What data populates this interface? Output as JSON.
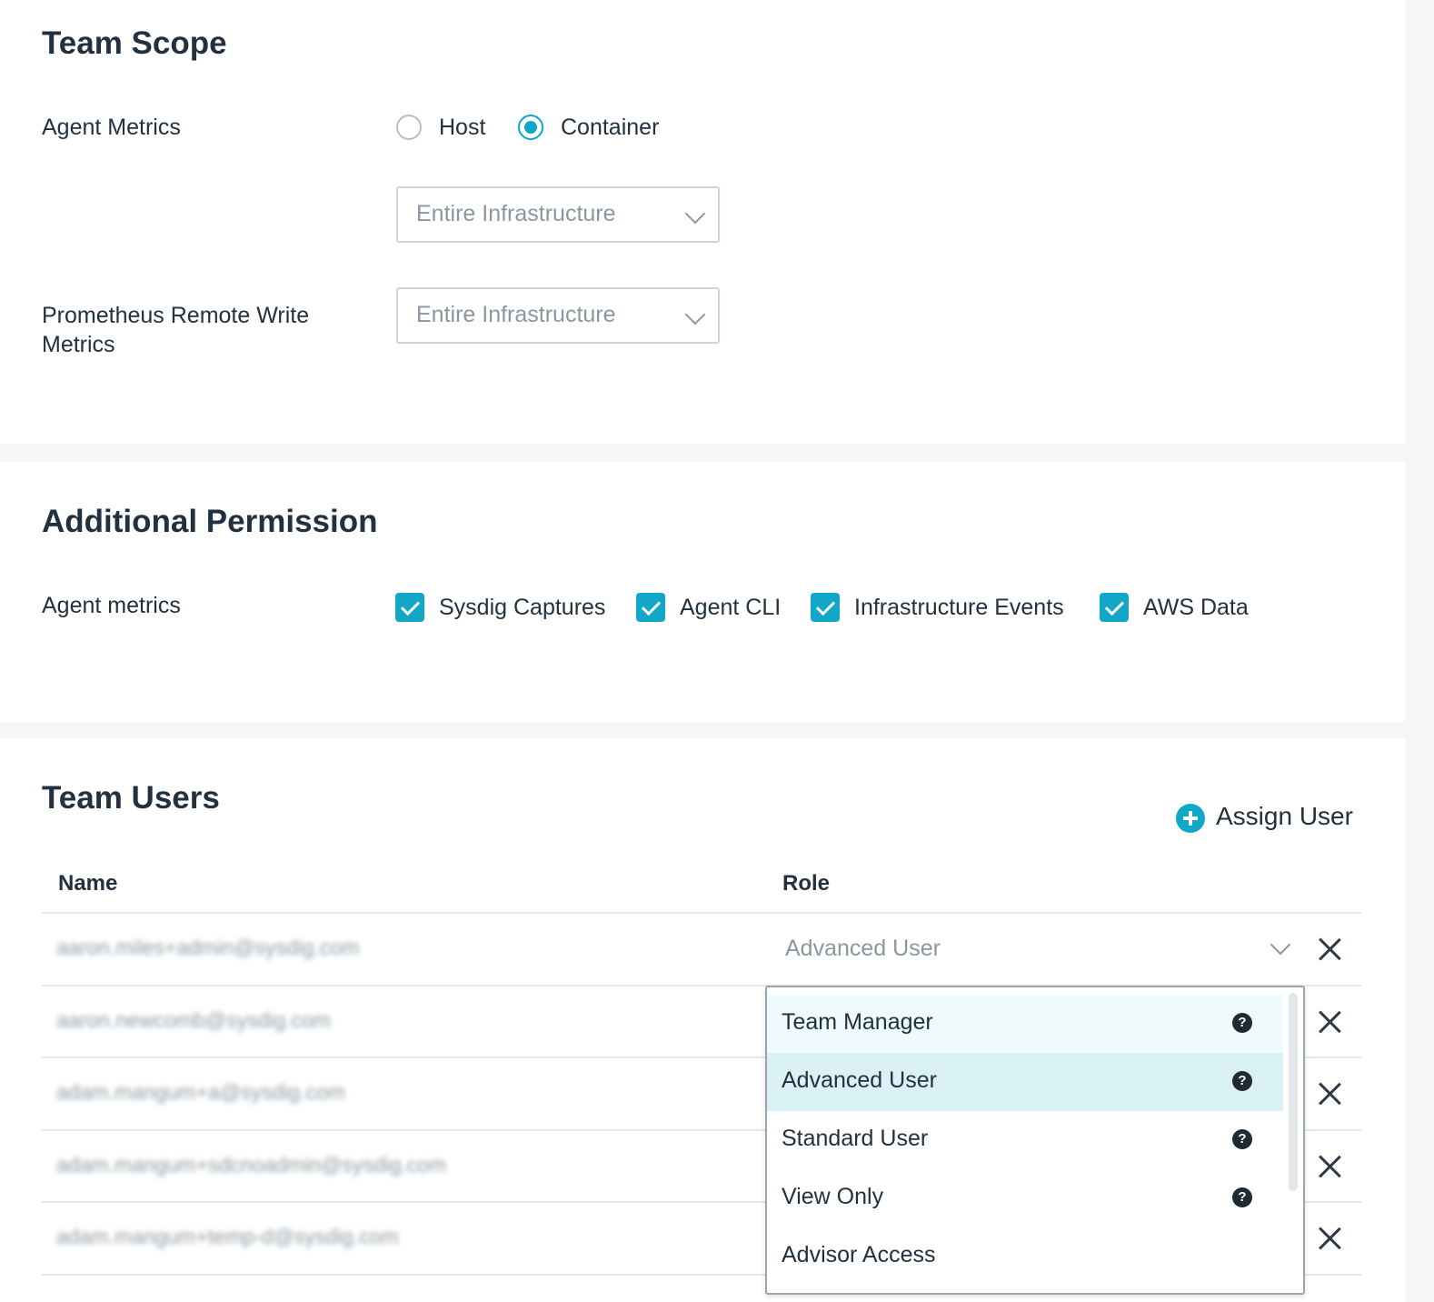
{
  "team_scope": {
    "title": "Team Scope",
    "agent_metrics_label": "Agent Metrics",
    "radio_options": [
      {
        "label": "Host",
        "selected": false
      },
      {
        "label": "Container",
        "selected": true
      }
    ],
    "agent_scope_select": "Entire Infrastructure",
    "prometheus_label": "Prometheus Remote Write Metrics",
    "prometheus_scope_select": "Entire Infrastructure"
  },
  "additional_permission": {
    "title": "Additional Permission",
    "label": "Agent metrics",
    "checkboxes": [
      {
        "label": "Sysdig Captures",
        "checked": true
      },
      {
        "label": "Agent CLI",
        "checked": true
      },
      {
        "label": "Infrastructure Events",
        "checked": true
      },
      {
        "label": "AWS Data",
        "checked": true
      }
    ]
  },
  "team_users": {
    "title": "Team Users",
    "assign_label": "Assign User",
    "columns": {
      "name": "Name",
      "role": "Role"
    },
    "rows": [
      {
        "name": "aaron.miles+admin@sysdig.com",
        "role": "Advanced User"
      },
      {
        "name": "aaron.newcomb@sysdig.com",
        "role": ""
      },
      {
        "name": "adam.mangum+a@sysdig.com",
        "role": ""
      },
      {
        "name": "adam.mangum+sdcnoadmin@sysdig.com",
        "role": ""
      },
      {
        "name": "adam.mangum+temp-d@sysdig.com",
        "role": ""
      }
    ]
  },
  "role_dropdown": {
    "options": [
      "Team Manager",
      "Advanced User",
      "Standard User",
      "View Only",
      "Advisor Access"
    ],
    "hovered": "Team Manager",
    "selected": "Advanced User",
    "help_glyph": "?"
  },
  "colors": {
    "accent": "#11a7c6",
    "text": "#22313f",
    "muted": "#8a97a1"
  }
}
